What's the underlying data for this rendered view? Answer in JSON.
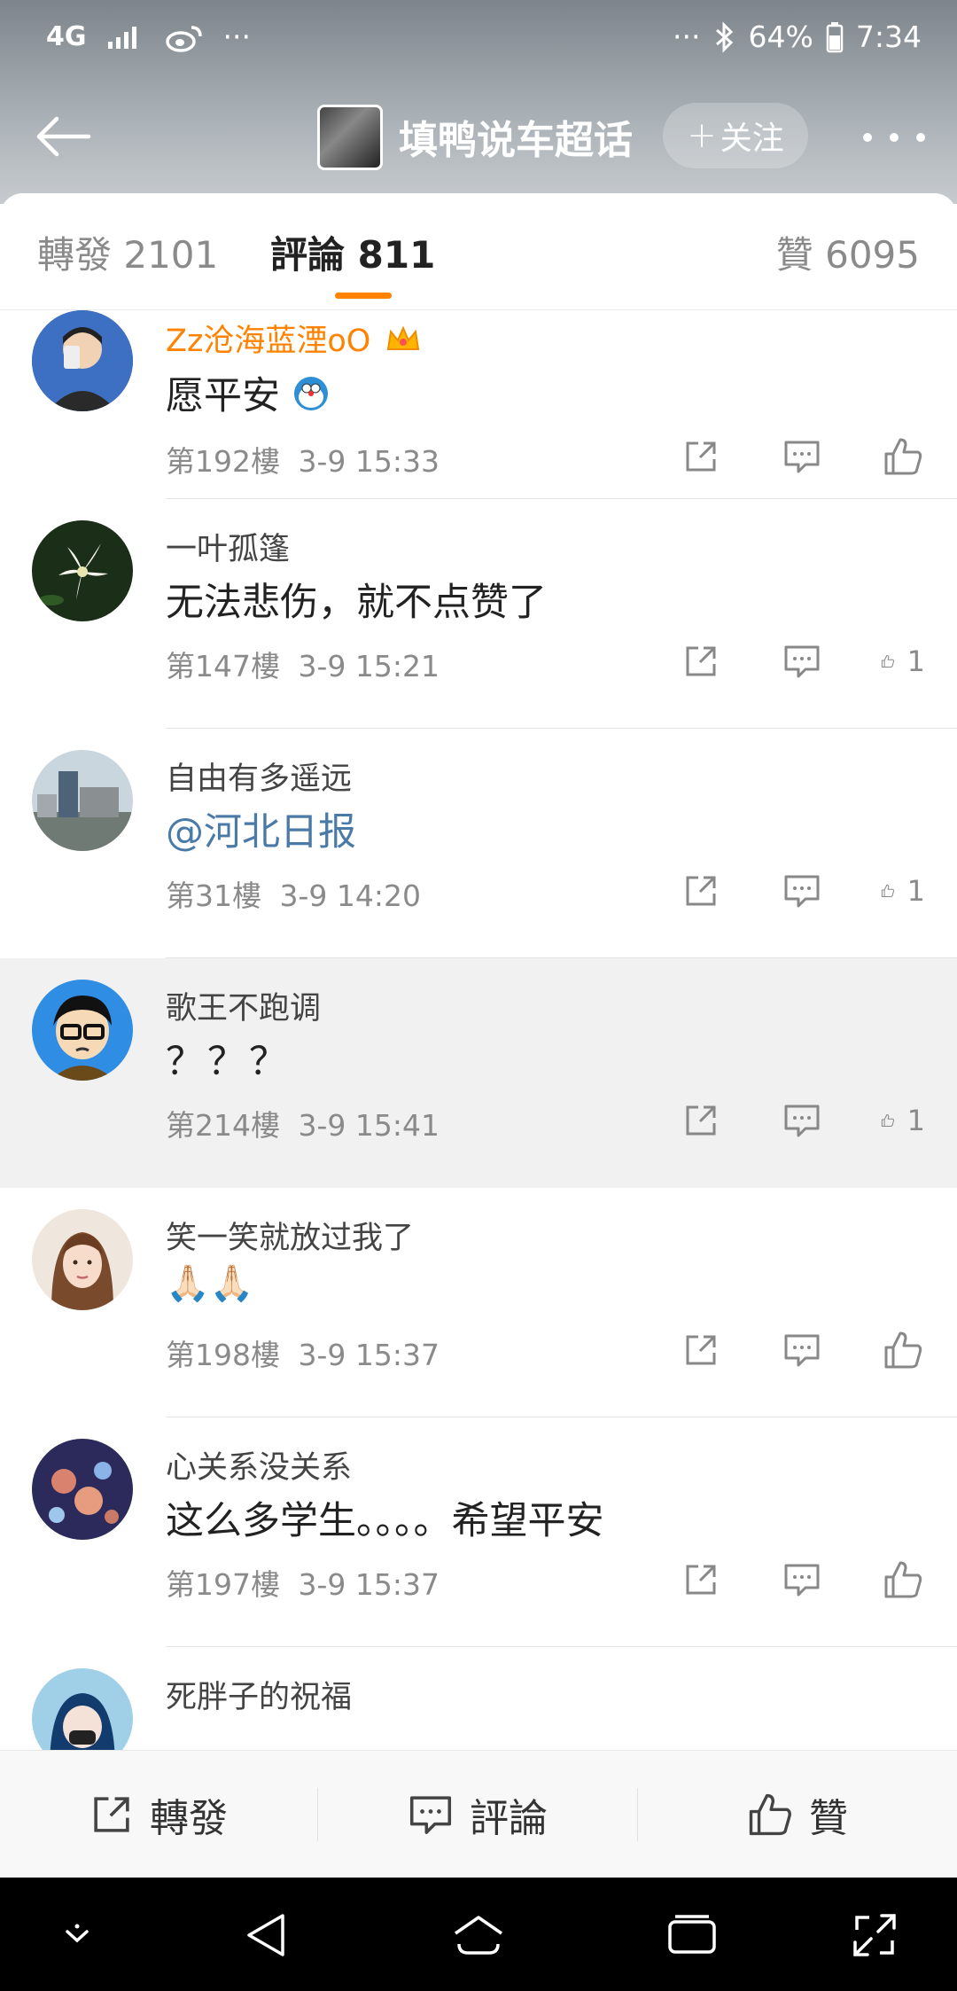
{
  "status_bar": {
    "network": "4G",
    "battery": "64%",
    "time": "7:34"
  },
  "header": {
    "topic_title": "填鸭说车超话",
    "follow_label": "关注"
  },
  "tabs": {
    "repost": "轉發 2101",
    "comments": "評論 811",
    "likes": "贊 6095"
  },
  "comments": [
    {
      "name": "Zz沧海蓝湮oO",
      "text": "愿平安",
      "floor": "第192樓",
      "time": "3-9 15:33",
      "likes": ""
    },
    {
      "name": "一叶孤篷",
      "text": "无法悲伤，就不点赞了",
      "floor": "第147樓",
      "time": "3-9 15:21",
      "likes": "1"
    },
    {
      "name": "自由有多遥远",
      "text": "@河北日报",
      "floor": "第31樓",
      "time": "3-9 14:20",
      "likes": "1"
    },
    {
      "name": "歌王不跑调",
      "text": "？？？",
      "floor": "第214樓",
      "time": "3-9 15:41",
      "likes": "1"
    },
    {
      "name": "笑一笑就放过我了",
      "text": "🙏🏻🙏🏻",
      "floor": "第198樓",
      "time": "3-9 15:37",
      "likes": ""
    },
    {
      "name": "心关系没关系",
      "text": "这么多学生。。。。希望平安",
      "floor": "第197樓",
      "time": "3-9 15:37",
      "likes": ""
    },
    {
      "name": "死胖子的祝福",
      "text": "",
      "floor": "",
      "time": "",
      "likes": ""
    }
  ],
  "bottom_bar": {
    "repost": "轉發",
    "comment": "評論",
    "like": "贊"
  },
  "colors": {
    "accent": "#ff8200",
    "mention": "#4a7aa8",
    "highlight_row": "#f1f1f1"
  }
}
